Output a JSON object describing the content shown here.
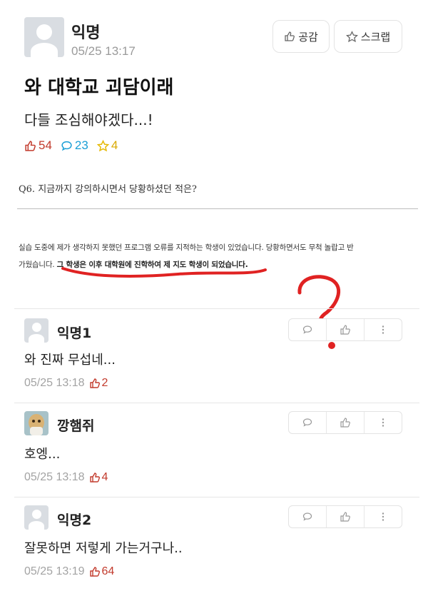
{
  "post": {
    "author": "익명",
    "time": "05/25 13:17",
    "title": "와 대학교 괴담이래",
    "body": "다들 조심해야겠다...!",
    "likes": "54",
    "comments": "23",
    "scraps": "4",
    "empathy_button": "공감",
    "scrap_button": "스크랩"
  },
  "image_text": {
    "question": "Q6. 지금까지 강의하시면서 당황하셨던 적은?",
    "answer_line1": "실습 도중에 제가 생각하지 못했던 프로그램 오류를 지적하는 학생이 있었습니다. 당황하면서도 무척 놀랍고 반",
    "answer_line2_a": "가웠습니다. ",
    "answer_line2_b": "그 학생은 이후 대학원에 진학하여 제 지도 학생이 되었습니다."
  },
  "comments": [
    {
      "author": "익명1",
      "body": "와 진짜 무섭네...",
      "time": "05/25 13:18",
      "likes": "2"
    },
    {
      "author": "깡햄쥐",
      "body": "호엥...",
      "time": "05/25 13:18",
      "likes": "4"
    },
    {
      "author": "익명2",
      "body": "잘못하면 저렇게 가는거구나..",
      "time": "05/25 13:19",
      "likes": "64"
    }
  ],
  "colors": {
    "like": "#c23a2c",
    "comment": "#1a9fd6",
    "scrap": "#e5b800",
    "annotation": "#e02222"
  }
}
